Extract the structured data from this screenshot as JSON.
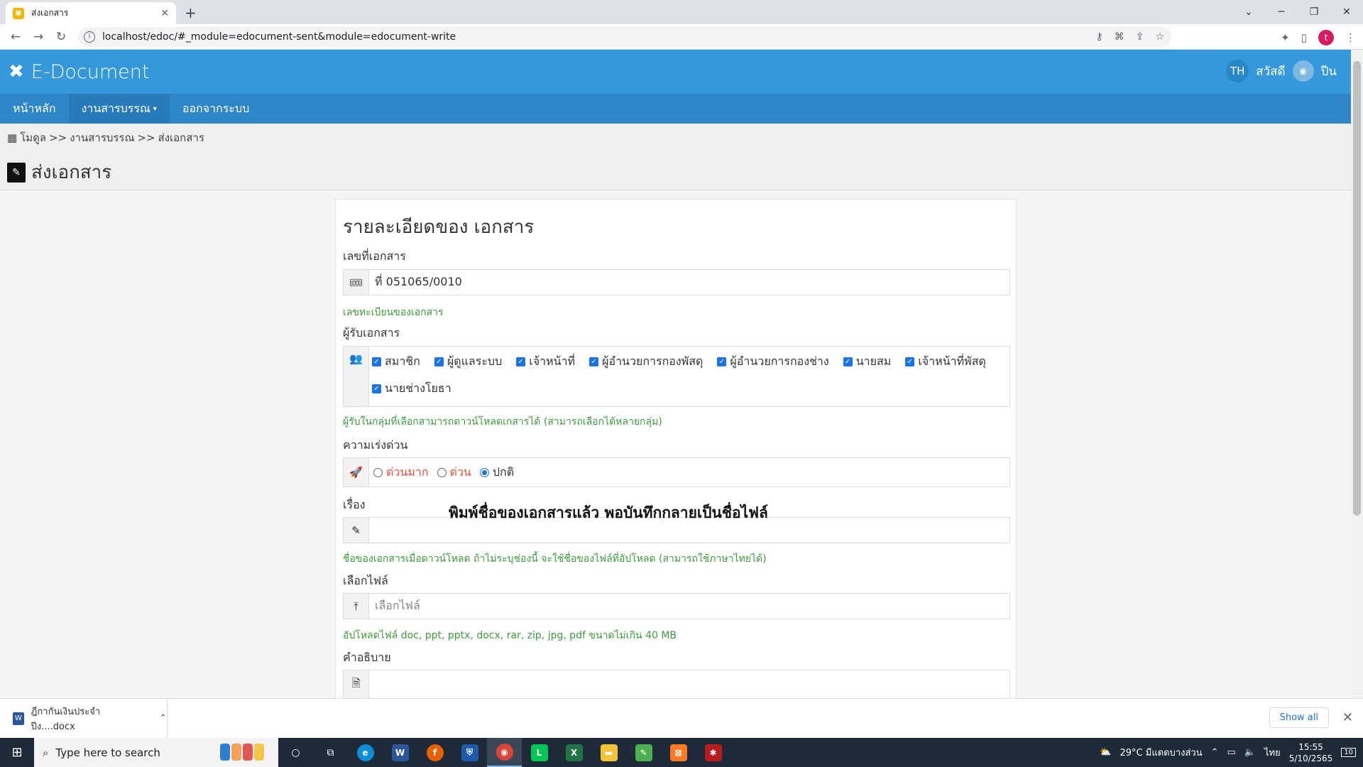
{
  "browser": {
    "tab_title": "ส่งเอกสาร",
    "url": "localhost/edoc/#_module=edocument-sent&module=edocument-write"
  },
  "app": {
    "brand": "E-Document",
    "lang": "TH",
    "greeting": "สวัสดี",
    "username": "ปีน"
  },
  "menu": {
    "home": "หน้าหลัก",
    "correspondence": "งานสารบรรณ",
    "logout": "ออกจากระบบ"
  },
  "breadcrumb": {
    "modules": "โมดูล",
    "sep1": ">>",
    "correspondence": "งานสารบรรณ",
    "sep2": ">>",
    "current": "ส่งเอกสาร"
  },
  "page": {
    "title": "ส่งเอกสาร"
  },
  "form": {
    "heading": "รายละเอียดของ เอกสาร",
    "doc_no_label": "เลขที่เอกสาร",
    "doc_no_value": "ที่ 051065/0010",
    "doc_no_help": "เลขทะเบียนของเอกสาร",
    "recipients_label": "ผู้รับเอกสาร",
    "recipients": [
      {
        "label": "สมาชิก",
        "checked": true
      },
      {
        "label": "ผู้ดูแลระบบ",
        "checked": true
      },
      {
        "label": "เจ้าหน้าที่",
        "checked": true
      },
      {
        "label": "ผู้อำนวยการกองพัสดุ",
        "checked": true
      },
      {
        "label": "ผู้อำนวยการกองช่าง",
        "checked": true
      },
      {
        "label": "นายสม",
        "checked": true
      },
      {
        "label": "เจ้าหน้าที่พัสดุ",
        "checked": true
      },
      {
        "label": "นายช่างโยธา",
        "checked": true
      }
    ],
    "recipients_help": "ผู้รับในกลุ่มที่เลือกสามารถดาวน์โหลดเกสารได้ (สามารถเลือกได้หลายกลุ่ม)",
    "urgency_label": "ความเร่งด่วน",
    "urgency": [
      {
        "label": "ด่วนมาก",
        "selected": false
      },
      {
        "label": "ด่วน",
        "selected": false
      },
      {
        "label": "ปกติ",
        "selected": true
      }
    ],
    "topic_label": "เรื่อง",
    "topic_value": "",
    "topic_help": "ชื่อของเอกสารเมื่อดาวน์โหลด ถ้าไม่ระบุช่องนี้ จะใช้ชื่อของไฟล์ที่อัปโหลด (สามารถใช้ภาษาไทยได้)",
    "file_label": "เลือกไฟล์",
    "file_placeholder": "เลือกไฟล์",
    "file_help": "อัปโหลดไฟล์ doc, ppt, pptx, docx, rar, zip, jpg, pdf ขนาดไม่เกิน 40 MB",
    "desc_label": "คำอธิบาย",
    "desc_value": ""
  },
  "overlay_note": "พิมพ์ชื่อของเอกสารแล้ว พอบันทึกกลายเป็นชื่อไฟล์",
  "downloads": {
    "file": "ฎีกากันเงินประจำปีง....docx",
    "show_all": "Show all"
  },
  "taskbar": {
    "search_placeholder": "Type here to search",
    "weather": "29°C มีแดดบางส่วน",
    "ime": "ไทย",
    "time": "15:55",
    "date": "5/10/2565",
    "notif_count": "10"
  },
  "colors": {
    "header": "#3498db",
    "menubar": "#2e86c8",
    "help_text": "#3c9b3c",
    "urgent_text": "#e74c3c"
  }
}
